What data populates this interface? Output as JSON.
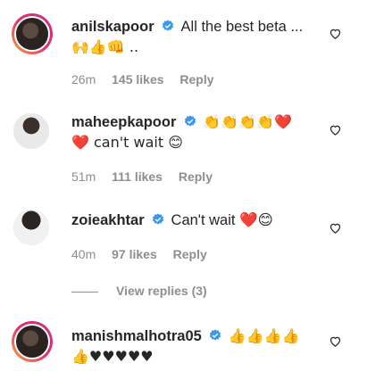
{
  "comments": [
    {
      "username": "anilskapoor",
      "text": "All the best beta ...",
      "emoji_line": "🙌👍👊 ..",
      "time": "26m",
      "likes": "145 likes",
      "reply": "Reply"
    },
    {
      "username": "maheepkapoor",
      "text": "👏👏👏👏❤️",
      "text2": "❤️ can't wait 😊",
      "time": "51m",
      "likes": "111 likes",
      "reply": "Reply"
    },
    {
      "username": "zoieakhtar",
      "text": "Can't wait ❤️😊",
      "time": "40m",
      "likes": "97 likes",
      "reply": "Reply"
    },
    {
      "username": "manishmalhotra05",
      "text": "👍👍👍👍",
      "text2": "👍♥♥♥♥♥",
      "time": "",
      "likes": "",
      "reply": ""
    }
  ],
  "view_replies": "View replies (3)",
  "colors": {
    "verified": "#3897f0",
    "meta": "#8e8e8e",
    "text": "#262626"
  }
}
